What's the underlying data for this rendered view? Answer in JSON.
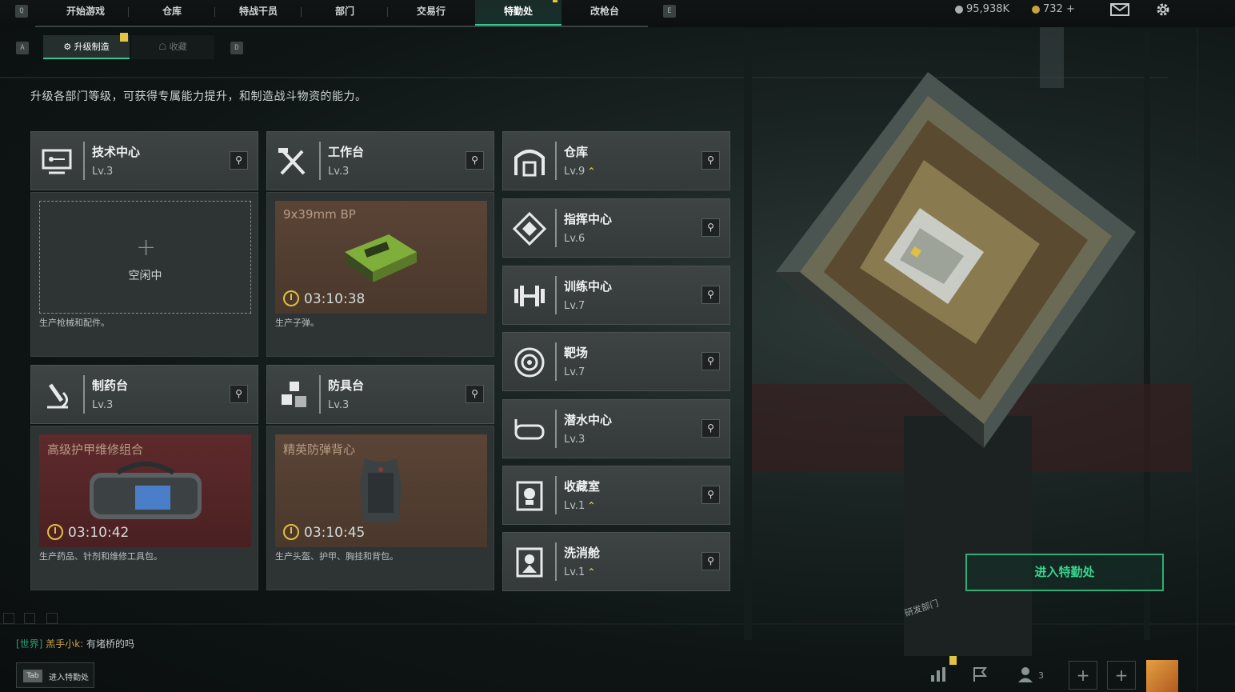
{
  "topbar": {
    "key_left": "Q",
    "key_right": "E",
    "tabs": [
      "开始游戏",
      "仓库",
      "特战干员",
      "部门",
      "交易行",
      "特勤处",
      "改枪台"
    ],
    "active_tab": "特勤处",
    "currency1": "95,938K",
    "currency2": "732",
    "plus": "+"
  },
  "subtabs": {
    "key_left": "A",
    "key_right": "D",
    "upgrade": "升级制造",
    "collect": "收藏"
  },
  "description": "升级各部门等级，可获得专属能力提升，和制造战斗物资的能力。",
  "stations": [
    {
      "name": "技术中心",
      "level": "Lv.3",
      "icon": "computer-icon",
      "status": "空闲中",
      "desc": "生产枪械和配件。"
    },
    {
      "name": "工作台",
      "level": "Lv.3",
      "icon": "tools-icon",
      "product": "9x39mm BP",
      "timer": "03:10:38",
      "desc": "生产子弹。"
    },
    {
      "name": "制药台",
      "level": "Lv.3",
      "icon": "microscope-icon",
      "product": "高级护甲维修组合",
      "timer": "03:10:42",
      "desc": "生产药品、针剂和维修工具包。"
    },
    {
      "name": "防具台",
      "level": "Lv.3",
      "icon": "cubes-icon",
      "product": "精英防弹背心",
      "timer": "03:10:45",
      "desc": "生产头盔、护甲、胸挂和背包。"
    }
  ],
  "departments": [
    {
      "name": "仓库",
      "level": "Lv.9",
      "upgrade": true,
      "icon": "warehouse-icon"
    },
    {
      "name": "指挥中心",
      "level": "Lv.6",
      "upgrade": false,
      "icon": "command-icon"
    },
    {
      "name": "训练中心",
      "level": "Lv.7",
      "upgrade": false,
      "icon": "dumbbell-icon"
    },
    {
      "name": "靶场",
      "level": "Lv.7",
      "upgrade": false,
      "icon": "target-icon"
    },
    {
      "name": "潜水中心",
      "level": "Lv.3",
      "upgrade": false,
      "icon": "goggles-icon"
    },
    {
      "name": "收藏室",
      "level": "Lv.1",
      "upgrade": true,
      "icon": "trophy-icon"
    },
    {
      "name": "洗消舱",
      "level": "Lv.1",
      "upgrade": true,
      "icon": "decon-icon"
    }
  ],
  "enter_button": "进入特勤处",
  "chat": {
    "channel": "[世界]",
    "user": "羔手小k:",
    "message": "有堵桥的吗"
  },
  "tab_hint": {
    "key": "Tab",
    "label": "进入特勤处"
  },
  "bottom": {
    "friends_count": "3",
    "sign_text": "研发部门"
  },
  "colors": {
    "accent": "#35c98f",
    "upgrade": "#e3c440"
  }
}
